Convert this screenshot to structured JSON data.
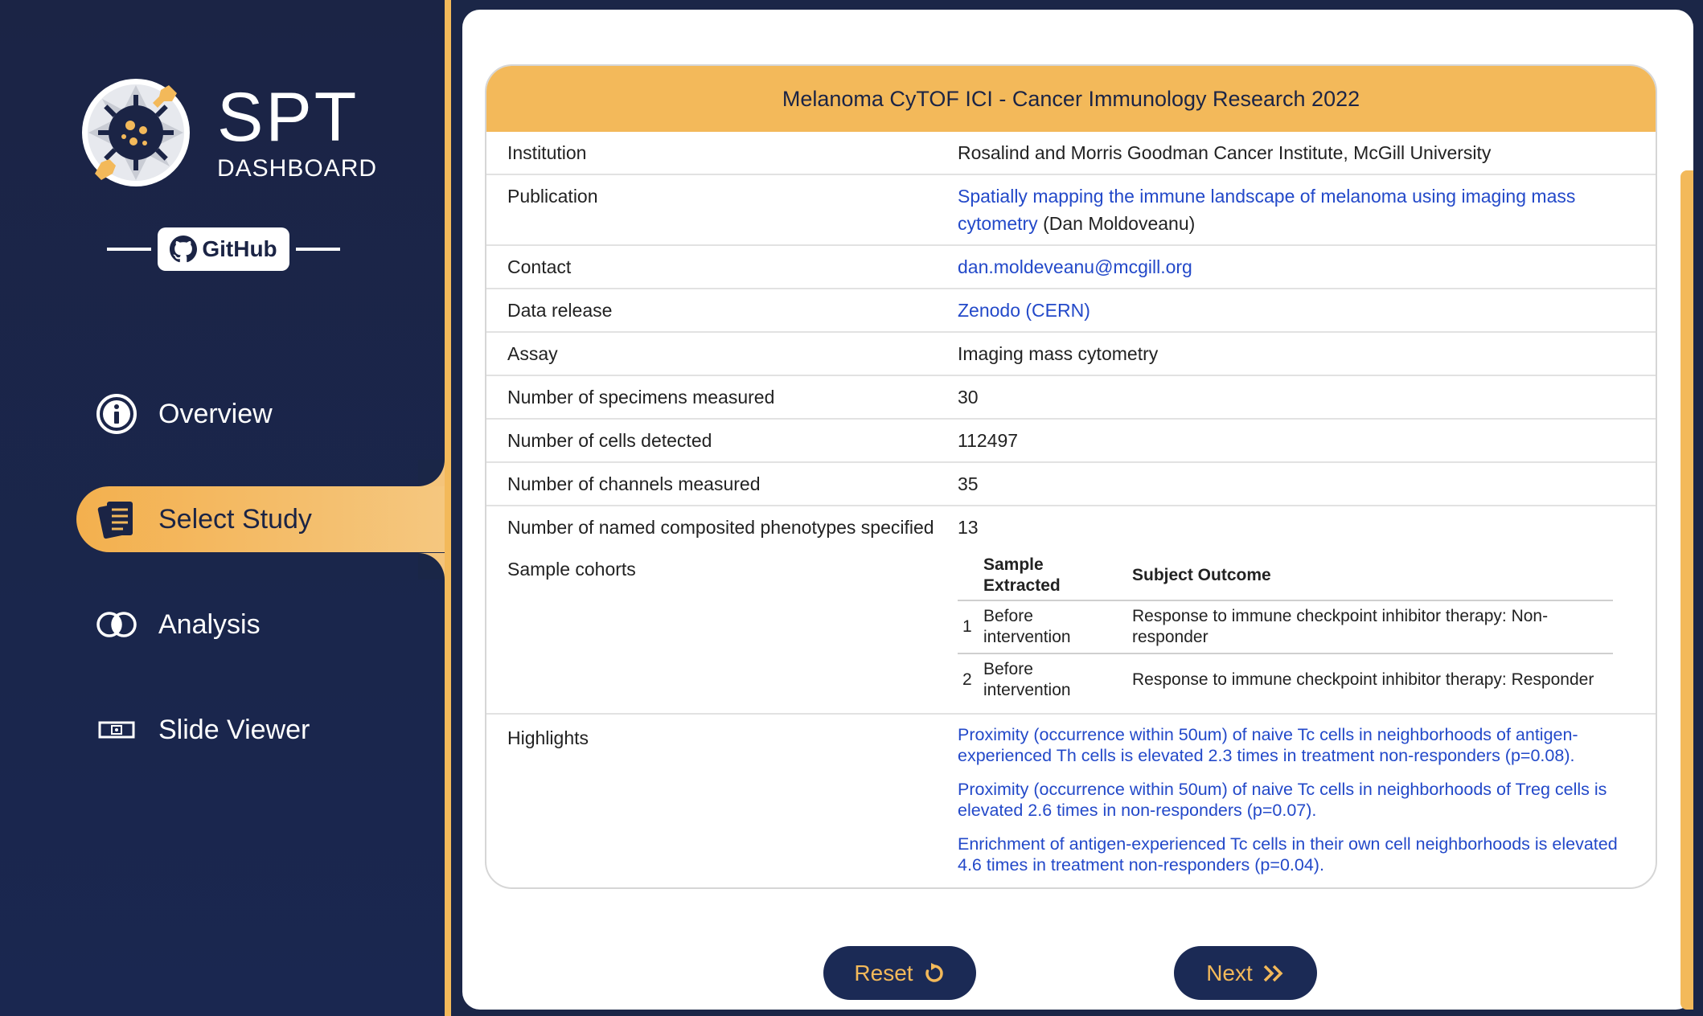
{
  "brand": {
    "title": "SPT",
    "subtitle": "DASHBOARD",
    "github_label": "GitHub"
  },
  "nav": {
    "items": [
      {
        "label": "Overview",
        "icon": "info-icon",
        "active": false
      },
      {
        "label": "Select Study",
        "icon": "documents-icon",
        "active": true
      },
      {
        "label": "Analysis",
        "icon": "venn-icon",
        "active": false
      },
      {
        "label": "Slide Viewer",
        "icon": "slide-icon",
        "active": false
      }
    ]
  },
  "study": {
    "title": "Melanoma CyTOF ICI - Cancer Immunology Research 2022",
    "institution_label": "Institution",
    "institution": "Rosalind and Morris Goodman Cancer Institute, McGill University",
    "publication_label": "Publication",
    "publication_link": "Spatially mapping the immune landscape of melanoma using imaging mass cytometry",
    "publication_author": "(Dan Moldoveanu)",
    "contact_label": "Contact",
    "contact": "dan.moldeveanu@mcgill.org",
    "data_release_label": "Data release",
    "data_release": "Zenodo (CERN)",
    "assay_label": "Assay",
    "assay": "Imaging mass cytometry",
    "specimens_label": "Number of specimens measured",
    "specimens": "30",
    "cells_label": "Number of cells detected",
    "cells": "112497",
    "channels_label": "Number of channels measured",
    "channels": "35",
    "phenotypes_label": "Number of named composited phenotypes specified",
    "phenotypes": "13",
    "cohorts_label": "Sample cohorts",
    "cohorts": {
      "headers": [
        "",
        "Sample Extracted",
        "Subject Outcome"
      ],
      "rows": [
        {
          "id": "1",
          "extracted": "Before intervention",
          "outcome": "Response to immune checkpoint inhibitor therapy: Non-responder"
        },
        {
          "id": "2",
          "extracted": "Before intervention",
          "outcome": "Response to immune checkpoint inhibitor therapy: Responder"
        }
      ]
    },
    "highlights_label": "Highlights",
    "highlights": [
      "Proximity (occurrence within 50um) of naive Tc cells in neighborhoods of antigen-experienced Th cells is elevated 2.3 times in treatment non-responders (p=0.08).",
      "Proximity (occurrence within 50um) of naive Tc cells in neighborhoods of Treg cells is elevated 2.6 times in non-responders (p=0.07).",
      "Enrichment of antigen-experienced Tc cells in their own cell neighborhoods is elevated 4.6 times in treatment non-responders (p=0.04)."
    ]
  },
  "buttons": {
    "reset": "Reset",
    "next": "Next"
  },
  "colors": {
    "accent": "#f3b95a",
    "navy": "#1b2445",
    "link": "#2349c9"
  }
}
